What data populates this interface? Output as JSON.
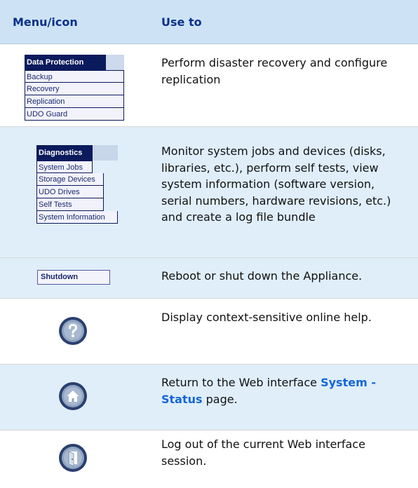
{
  "header": {
    "col1": "Menu/icon",
    "col2": "Use to"
  },
  "rows": {
    "data_protection": {
      "menu_title": "Data Protection",
      "items": [
        "Backup",
        "Recovery",
        "Replication",
        "UDO Guard"
      ],
      "desc": "Perform disaster recovery and configure replication"
    },
    "diagnostics": {
      "menu_title": "Diagnostics",
      "items": [
        "System Jobs",
        "Storage Devices",
        "UDO Drives",
        "Self Tests",
        "System Information"
      ],
      "desc": "Monitor system jobs and devices (disks, libraries, etc.), perform self tests, view system information (software version, serial numbers, hardware revisions, etc.) and create a log file bundle"
    },
    "shutdown": {
      "button_label": "Shutdown",
      "desc": "Reboot or shut down the Appliance."
    },
    "help": {
      "icon": "help-icon",
      "desc": "Display context-sensitive online help."
    },
    "home": {
      "icon": "home-icon",
      "desc_pre": "Return to the Web interface ",
      "desc_highlight": "System - Status",
      "desc_post": " page."
    },
    "logout": {
      "icon": "logout-icon",
      "desc": "Log out of the current Web interface session."
    }
  },
  "colors": {
    "header_bg": "#cde3f5",
    "header_text": "#0a2f8c",
    "alt_row_bg": "#dfeef9",
    "highlight": "#1566d6",
    "menu_dark": "#0a1a5c"
  }
}
